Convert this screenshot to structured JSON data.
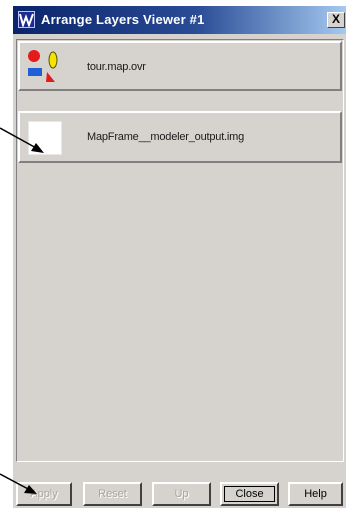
{
  "window": {
    "title": "Arrange Layers Viewer #1",
    "close_symbol": "X"
  },
  "layers": [
    {
      "label": "tour.map.ovr",
      "icon": "vector-layer-icon"
    },
    {
      "label": "MapFrame__modeler_output.img",
      "icon": "raster-layer-icon"
    }
  ],
  "buttons": {
    "apply": "Apply",
    "reset": "Reset",
    "up": "Up",
    "close": "Close",
    "help": "Help"
  }
}
